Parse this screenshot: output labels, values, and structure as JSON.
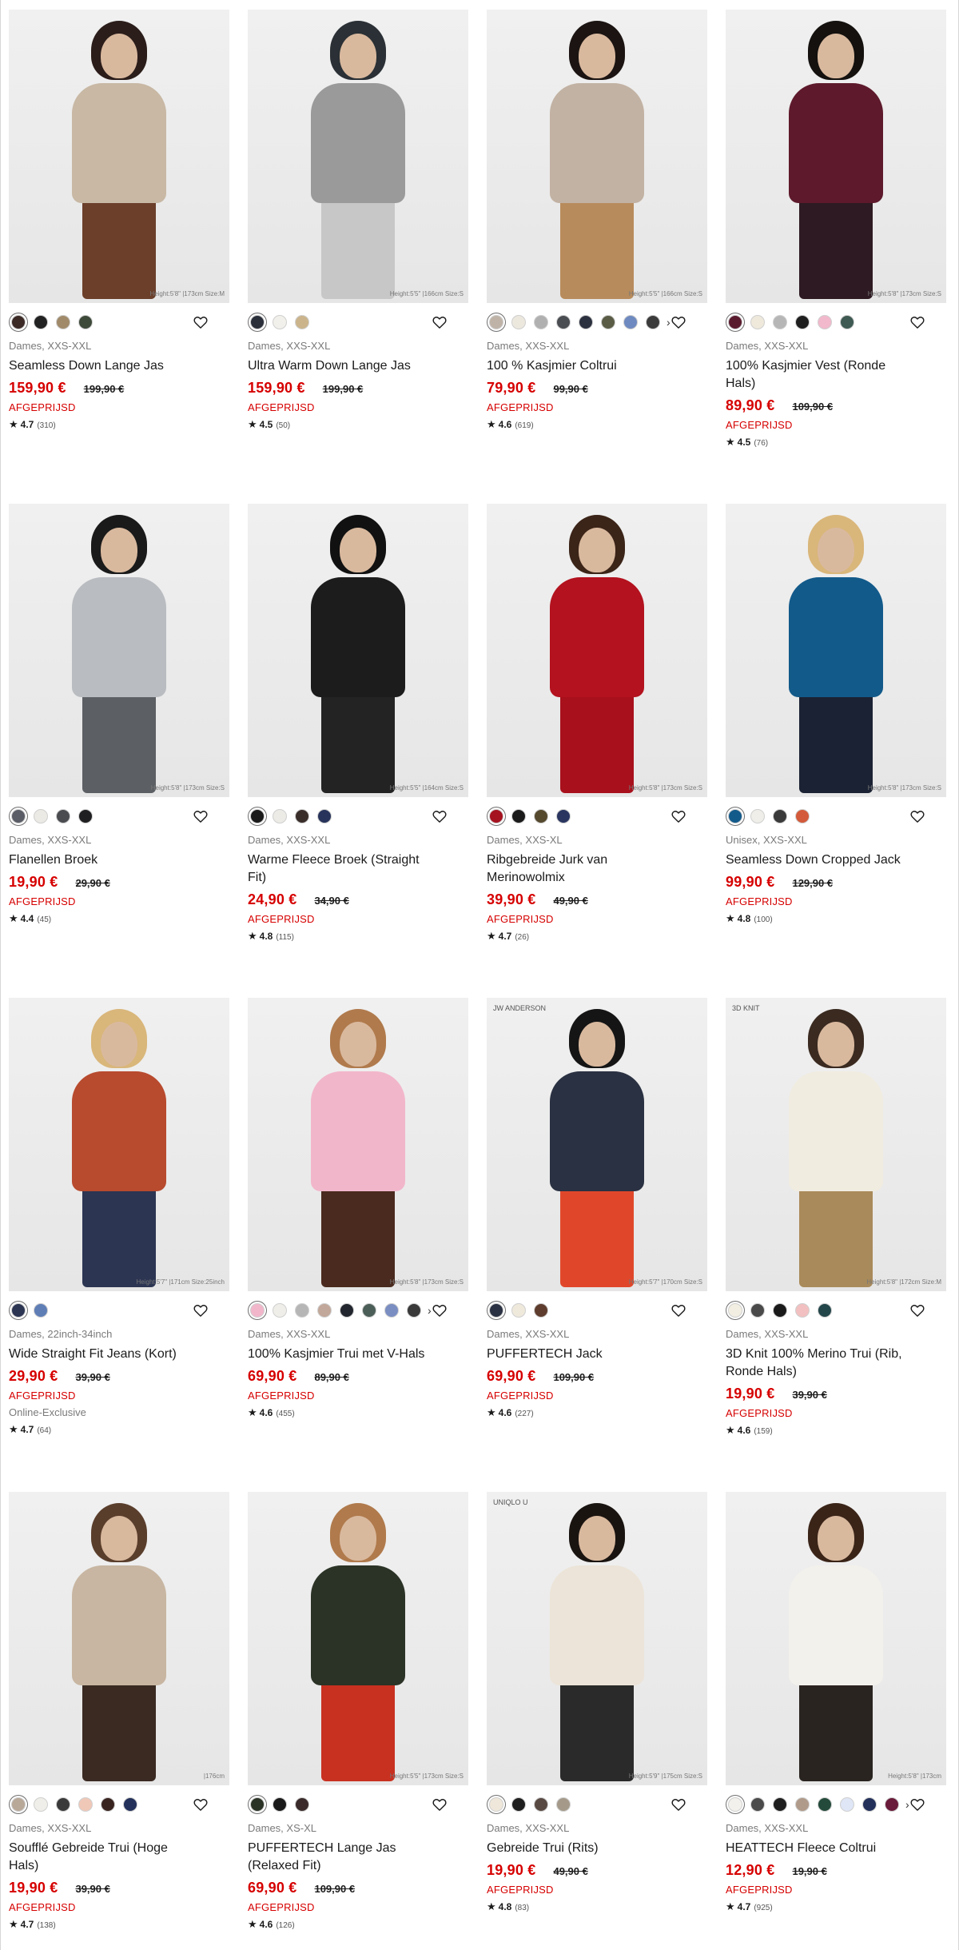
{
  "products": [
    {
      "category": "Dames, XXS-XXL",
      "name": "Seamless Down Lange Jas",
      "price": "159,90 €",
      "old_price": "199,90 €",
      "flag": "AFGEPRIJSD",
      "online": "",
      "score": "4.7",
      "count": "(310)",
      "size_note": "Height:5'8\" |173cm Size:M",
      "brand": "",
      "bg": [
        "#2b1d1a",
        "#c8b8a4",
        "#6b3f2a"
      ],
      "colors": [
        "#3b2a26",
        "#222222",
        "#a08a6a",
        "#3d4a3a"
      ]
    },
    {
      "category": "Dames, XXS-XXL",
      "name": "Ultra Warm Down Lange Jas",
      "price": "159,90 €",
      "old_price": "199,90 €",
      "flag": "AFGEPRIJSD",
      "online": "",
      "score": "4.5",
      "count": "(50)",
      "size_note": "Height:5'5\" |166cm Size:S",
      "brand": "",
      "bg": [
        "#2a3035",
        "#9a9a9a",
        "#c7c7c7"
      ],
      "colors": [
        "#2a2f3a",
        "#f2f0ea",
        "#cbb48c"
      ]
    },
    {
      "category": "Dames, XXS-XXL",
      "name": "100 % Kasjmier Coltrui",
      "price": "79,90 €",
      "old_price": "99,90 €",
      "flag": "AFGEPRIJSD",
      "online": "",
      "score": "4.6",
      "count": "(619)",
      "size_note": "Height:5'5\" |166cm Size:S",
      "brand": "",
      "bg": [
        "#1b1412",
        "#c2b2a3",
        "#b88b5c"
      ],
      "colors": [
        "#bfb3a7",
        "#ece8de",
        "#b0b0b0",
        "#4a4d52",
        "#2c3140",
        "#5a5c45",
        "#6f8ac0",
        "#3b3b3b"
      ]
    },
    {
      "category": "Dames, XXS-XXL",
      "name": "100% Kasjmier Vest (Ronde Hals)",
      "price": "89,90 €",
      "old_price": "109,90 €",
      "flag": "AFGEPRIJSD",
      "online": "",
      "score": "4.5",
      "count": "(76)",
      "size_note": "Height:5'8\" |173cm Size:S",
      "brand": "",
      "bg": [
        "#14110f",
        "#5e1a2c",
        "#2e1a22"
      ],
      "colors": [
        "#5a1a2e",
        "#efe9dc",
        "#b6b6b6",
        "#1f1f1f",
        "#f2b8cc",
        "#3e5a52"
      ]
    },
    {
      "category": "Dames, XXS-XXL",
      "name": "Flanellen Broek",
      "price": "19,90 €",
      "old_price": "29,90 €",
      "flag": "AFGEPRIJSD",
      "online": "",
      "score": "4.4",
      "count": "(45)",
      "size_note": "Height:5'8\" |173cm Size:S",
      "brand": "",
      "bg": [
        "#1a1a1a",
        "#b9bcc0",
        "#5c5f63"
      ],
      "colors": [
        "#5a5d66",
        "#eceae4",
        "#4a4c50",
        "#1f1f22"
      ]
    },
    {
      "category": "Dames, XXS-XXL",
      "name": "Warme Fleece Broek (Straight Fit)",
      "price": "24,90 €",
      "old_price": "34,90 €",
      "flag": "AFGEPRIJSD",
      "online": "",
      "score": "4.8",
      "count": "(115)",
      "size_note": "Height:5'5\" |164cm Size:S",
      "brand": "",
      "bg": [
        "#111111",
        "#1c1c1c",
        "#232323"
      ],
      "colors": [
        "#1a1a1a",
        "#ecebe6",
        "#3a2e2a",
        "#27335a"
      ]
    },
    {
      "category": "Dames, XXS-XL",
      "name": "Ribgebreide Jurk van Merinowolmix",
      "price": "39,90 €",
      "old_price": "49,90 €",
      "flag": "AFGEPRIJSD",
      "online": "",
      "score": "4.7",
      "count": "(26)",
      "size_note": "Height:5'8\" |173cm Size:S",
      "brand": "",
      "bg": [
        "#3b2418",
        "#b3121e",
        "#a8101c"
      ],
      "colors": [
        "#a51220",
        "#1a1a1a",
        "#55492e",
        "#2a3560"
      ]
    },
    {
      "category": "Unisex, XXS-XXL",
      "name": "Seamless Down Cropped Jack",
      "price": "99,90 €",
      "old_price": "129,90 €",
      "flag": "AFGEPRIJSD",
      "online": "",
      "score": "4.8",
      "count": "(100)",
      "size_note": "Height:5'8\" |173cm Size:S",
      "brand": "",
      "bg": [
        "#d9b67a",
        "#125a8a",
        "#1b2233"
      ],
      "colors": [
        "#125a8a",
        "#efeee8",
        "#3a3a3a",
        "#d35a3a"
      ]
    },
    {
      "category": "Dames, 22inch-34inch",
      "name": "Wide Straight Fit Jeans (Kort)",
      "price": "29,90 €",
      "old_price": "39,90 €",
      "flag": "AFGEPRIJSD",
      "online": "Online-Exclusive",
      "score": "4.7",
      "count": "(64)",
      "size_note": "Height:5'7\" |171cm Size:25inch",
      "brand": "",
      "bg": [
        "#d9b67a",
        "#b84a2e",
        "#2c3552"
      ],
      "colors": [
        "#2c3552",
        "#5f7eb6"
      ]
    },
    {
      "category": "Dames, XXS-XXL",
      "name": "100% Kasjmier Trui met V-Hals",
      "price": "69,90 €",
      "old_price": "89,90 €",
      "flag": "AFGEPRIJSD",
      "online": "",
      "score": "4.6",
      "count": "(455)",
      "size_note": "Height:5'8\" |173cm Size:S",
      "brand": "",
      "bg": [
        "#b07a4c",
        "#f2b6cb",
        "#4a2a1e"
      ],
      "colors": [
        "#f2b6cb",
        "#efeee8",
        "#b6b6b6",
        "#c2a89a",
        "#22262e",
        "#4c5e58",
        "#7a8ec2",
        "#3a3a3a"
      ]
    },
    {
      "category": "Dames, XXS-XXL",
      "name": "PUFFERTECH Jack",
      "price": "69,90 €",
      "old_price": "109,90 €",
      "flag": "AFGEPRIJSD",
      "online": "",
      "score": "4.6",
      "count": "(227)",
      "size_note": "Height:5'7\" |170cm Size:S",
      "brand": "JW ANDERSON",
      "bg": [
        "#151515",
        "#2a3142",
        "#e0472a"
      ],
      "colors": [
        "#2a3142",
        "#efe9dc",
        "#5e3d2e"
      ]
    },
    {
      "category": "Dames, XXS-XXL",
      "name": "3D Knit 100% Merino Trui (Rib, Ronde Hals)",
      "price": "19,90 €",
      "old_price": "39,90 €",
      "flag": "AFGEPRIJSD",
      "online": "",
      "score": "4.6",
      "count": "(159)",
      "size_note": "Height:5'8\" |172cm Size:M",
      "brand": "3D KNIT",
      "bg": [
        "#3a2a20",
        "#f1ece0",
        "#a98a5a"
      ],
      "colors": [
        "#f2eee2",
        "#4a4a4a",
        "#1a1a1a",
        "#f2c0c0",
        "#23464a"
      ]
    },
    {
      "category": "Dames, XXS-XXL",
      "name": "Soufflé Gebreide Trui (Hoge Hals)",
      "price": "19,90 €",
      "old_price": "39,90 €",
      "flag": "AFGEPRIJSD",
      "online": "",
      "score": "4.7",
      "count": "(138)",
      "size_note": "|176cm",
      "brand": "",
      "bg": [
        "#5a3e2c",
        "#c8b6a2",
        "#3a2a22"
      ],
      "colors": [
        "#b8a898",
        "#efeee8",
        "#3a3a3a",
        "#f0c8b8",
        "#3a2420",
        "#22305a"
      ]
    },
    {
      "category": "Dames, XS-XL",
      "name": "PUFFERTECH Lange Jas (Relaxed Fit)",
      "price": "69,90 €",
      "old_price": "109,90 €",
      "flag": "AFGEPRIJSD",
      "online": "",
      "score": "4.6",
      "count": "(126)",
      "size_note": "Height:5'5\" |173cm Size:S",
      "brand": "",
      "bg": [
        "#b07a4c",
        "#2b3326",
        "#c83020"
      ],
      "colors": [
        "#2b3326",
        "#1a1a1a",
        "#3a2a2a"
      ]
    },
    {
      "category": "Dames, XXS-XXL",
      "name": "Gebreide Trui (Rits)",
      "price": "19,90 €",
      "old_price": "49,90 €",
      "flag": "AFGEPRIJSD",
      "online": "",
      "score": "4.8",
      "count": "(83)",
      "size_note": "Height:5'9\" |175cm Size:S",
      "brand": "UNIQLO U",
      "bg": [
        "#1a1411",
        "#ece4d8",
        "#2a2a2a"
      ],
      "colors": [
        "#efe7da",
        "#1f1f1f",
        "#5a4a44",
        "#a59a8a"
      ]
    },
    {
      "category": "Dames, XXS-XXL",
      "name": "HEATTECH Fleece Coltrui",
      "price": "12,90 €",
      "old_price": "19,90 €",
      "flag": "AFGEPRIJSD",
      "online": "",
      "score": "4.7",
      "count": "(925)",
      "size_note": "Height:5'8\" |173cm",
      "brand": "",
      "bg": [
        "#3a2418",
        "#f3f1ec",
        "#2a2420"
      ],
      "colors": [
        "#f3f1ec",
        "#4a4a4a",
        "#1f1f1f",
        "#b09a8a",
        "#234a3a",
        "#dfe6f6",
        "#22305a",
        "#6a1a3a"
      ]
    }
  ]
}
